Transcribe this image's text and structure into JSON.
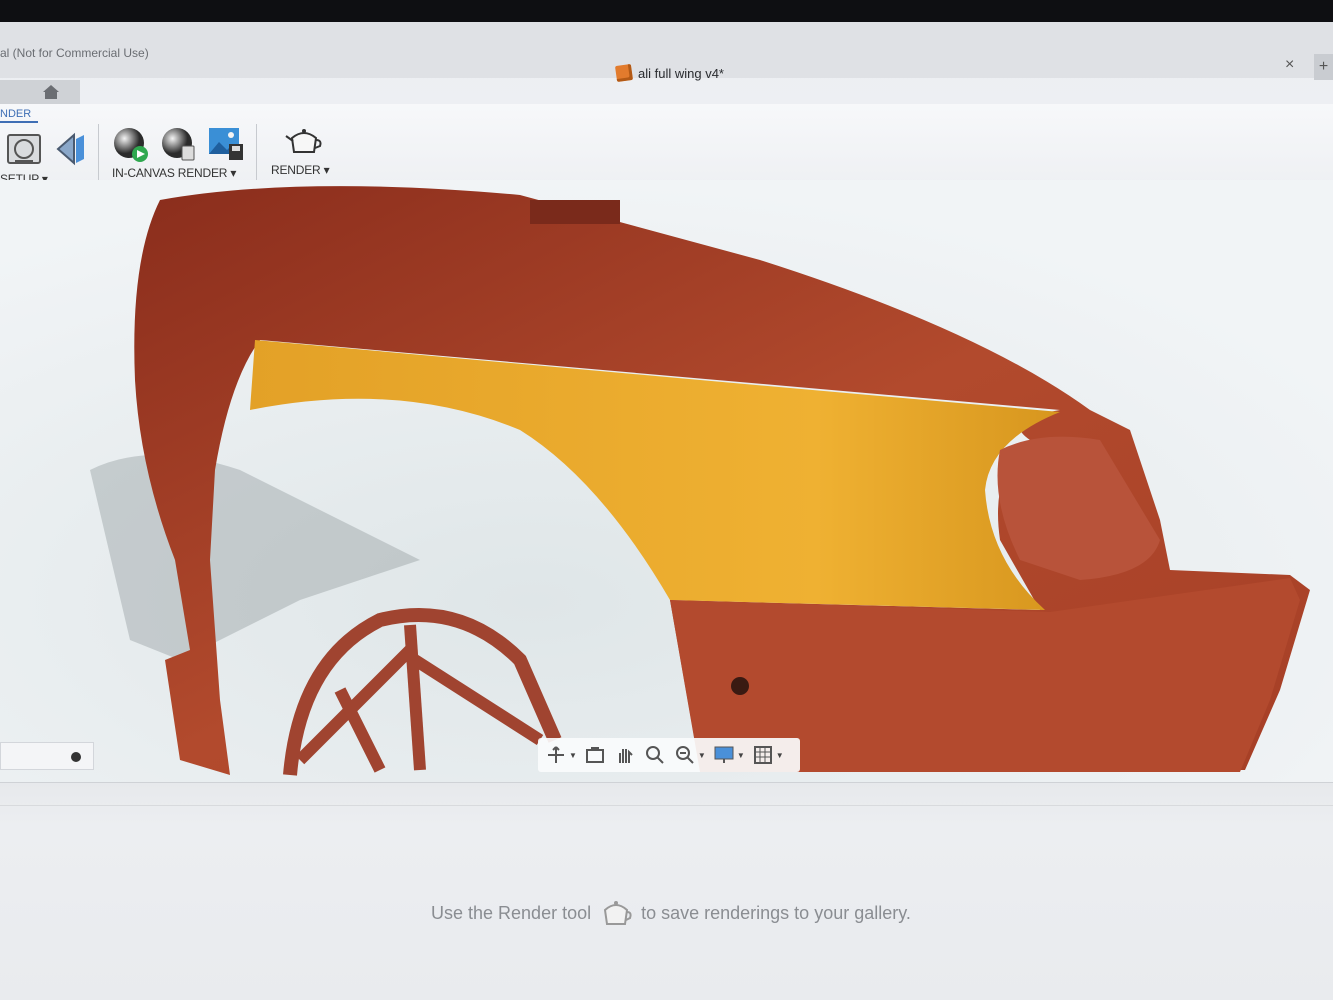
{
  "window": {
    "app_title": "al (Not for Commercial Use)",
    "document_tab": "ali full wing v4*",
    "close_symbol": "×",
    "new_tab_symbol": "+"
  },
  "ribbon": {
    "active_tab": "NDER",
    "groups": [
      {
        "label": "SETUP ▾"
      },
      {
        "label": "IN-CANVAS RENDER ▾"
      },
      {
        "label": "RENDER ▾"
      }
    ]
  },
  "status": {
    "hint_before": "Use the Render tool",
    "hint_after": "to save renderings to your gallery."
  },
  "colors": {
    "body_red": "#b4482c",
    "panel_yellow": "#e7a52a",
    "accent_blue": "#3f6fb5"
  },
  "icons": [
    "home-icon",
    "scene-settings-icon",
    "decal-icon",
    "render-play-icon",
    "render-settings-icon",
    "capture-image-icon",
    "teapot-icon",
    "orbit-icon",
    "look-at-icon",
    "pan-icon",
    "zoom-icon",
    "fit-icon",
    "display-settings-icon",
    "grid-icon"
  ]
}
